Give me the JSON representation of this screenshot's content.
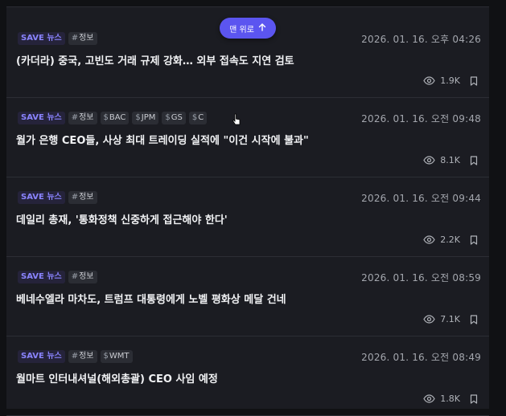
{
  "top_button": {
    "label": "맨 위로"
  },
  "articles": [
    {
      "source": "SAVE 뉴스",
      "tags": [
        {
          "prefix": "#",
          "text": "정보"
        }
      ],
      "date": "2026. 01. 16. 오후 04:26",
      "title": "(카더라) 중국, 고빈도 거래 규제 강화… 외부 접속도 지연 검토",
      "views": "1.9K"
    },
    {
      "source": "SAVE 뉴스",
      "tags": [
        {
          "prefix": "#",
          "text": "정보"
        },
        {
          "prefix": "$",
          "text": "BAC"
        },
        {
          "prefix": "$",
          "text": "JPM"
        },
        {
          "prefix": "$",
          "text": "GS"
        },
        {
          "prefix": "$",
          "text": "C"
        }
      ],
      "date": "2026. 01. 16. 오전 09:48",
      "title": "월가 은행 CEO들, 사상 최대 트레이딩 실적에 \"이건 시작에 불과\"",
      "views": "8.1K"
    },
    {
      "source": "SAVE 뉴스",
      "tags": [
        {
          "prefix": "#",
          "text": "정보"
        }
      ],
      "date": "2026. 01. 16. 오전 09:44",
      "title": "데일리 총재, '통화정책 신중하게 접근해야 한다'",
      "views": "2.2K"
    },
    {
      "source": "SAVE 뉴스",
      "tags": [
        {
          "prefix": "#",
          "text": "정보"
        }
      ],
      "date": "2026. 01. 16. 오전 08:59",
      "title": "베네수엘라 마차도, 트럼프 대통령에게 노벨 평화상 메달 건네",
      "views": "7.1K"
    },
    {
      "source": "SAVE 뉴스",
      "tags": [
        {
          "prefix": "#",
          "text": "정보"
        },
        {
          "prefix": "$",
          "text": "WMT"
        }
      ],
      "date": "2026. 01. 16. 오전 08:49",
      "title": "월마트 인터내셔널(해외총괄) CEO 사임 예정",
      "views": "1.8K"
    }
  ]
}
